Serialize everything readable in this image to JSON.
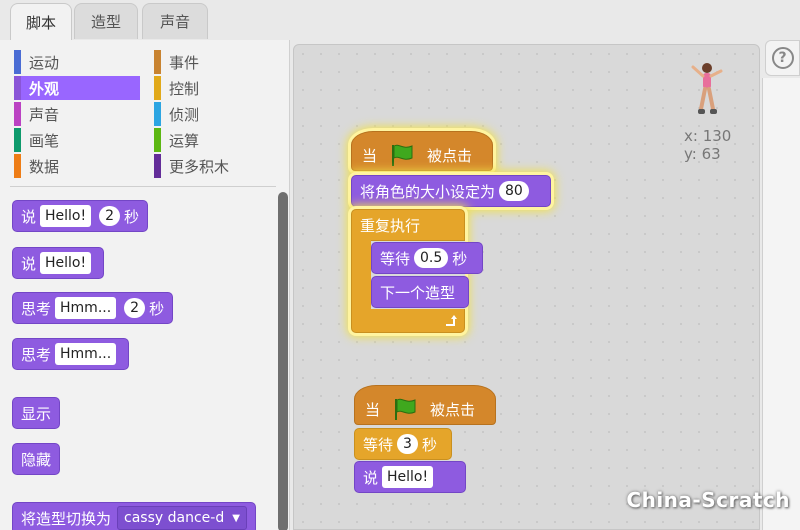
{
  "tabs": [
    {
      "label": "脚本",
      "active": true
    },
    {
      "label": "造型",
      "active": false
    },
    {
      "label": "声音",
      "active": false
    }
  ],
  "categories": {
    "left": [
      {
        "label": "运动",
        "color": "#4a6cd4"
      },
      {
        "label": "外观",
        "color": "#8a55d7",
        "selected": true
      },
      {
        "label": "声音",
        "color": "#bb42c3"
      },
      {
        "label": "画笔",
        "color": "#0e9a6c"
      },
      {
        "label": "数据",
        "color": "#ee7d16"
      }
    ],
    "right": [
      {
        "label": "事件",
        "color": "#c88330"
      },
      {
        "label": "控制",
        "color": "#e1a91a"
      },
      {
        "label": "侦测",
        "color": "#2ca5e2"
      },
      {
        "label": "运算",
        "color": "#5cb712"
      },
      {
        "label": "更多积木",
        "color": "#632d99"
      }
    ]
  },
  "palette_blocks": {
    "say_secs": {
      "prefix": "说",
      "text": "Hello!",
      "secs": "2",
      "suffix": "秒"
    },
    "say": {
      "prefix": "说",
      "text": "Hello!"
    },
    "think_secs": {
      "prefix": "思考",
      "text": "Hmm...",
      "secs": "2",
      "suffix": "秒"
    },
    "think": {
      "prefix": "思考",
      "text": "Hmm..."
    },
    "show": {
      "label": "显示"
    },
    "hide": {
      "label": "隐藏"
    },
    "switch_costume": {
      "label": "将造型切换为",
      "value": "cassy dance-d"
    }
  },
  "script1": {
    "hat": {
      "prefix": "当",
      "suffix": "被点击"
    },
    "set_size": {
      "label": "将角色的大小设定为",
      "value": "80"
    },
    "forever": {
      "label": "重复执行"
    },
    "wait": {
      "label": "等待",
      "value": "0.5",
      "suffix": "秒"
    },
    "next_costume": {
      "label": "下一个造型"
    }
  },
  "script2": {
    "hat": {
      "prefix": "当",
      "suffix": "被点击"
    },
    "wait": {
      "label": "等待",
      "value": "3",
      "suffix": "秒"
    },
    "say": {
      "label": "说",
      "value": "Hello!"
    }
  },
  "sprite_info": {
    "x_label": "x: 130",
    "y_label": "y: 63"
  },
  "help_icon": "?",
  "watermark": "China-Scratch",
  "colors": {
    "looks": "#8e5be0",
    "events": "#d4872b",
    "control": "#e5a52a",
    "selected_category": "#9966ff"
  }
}
